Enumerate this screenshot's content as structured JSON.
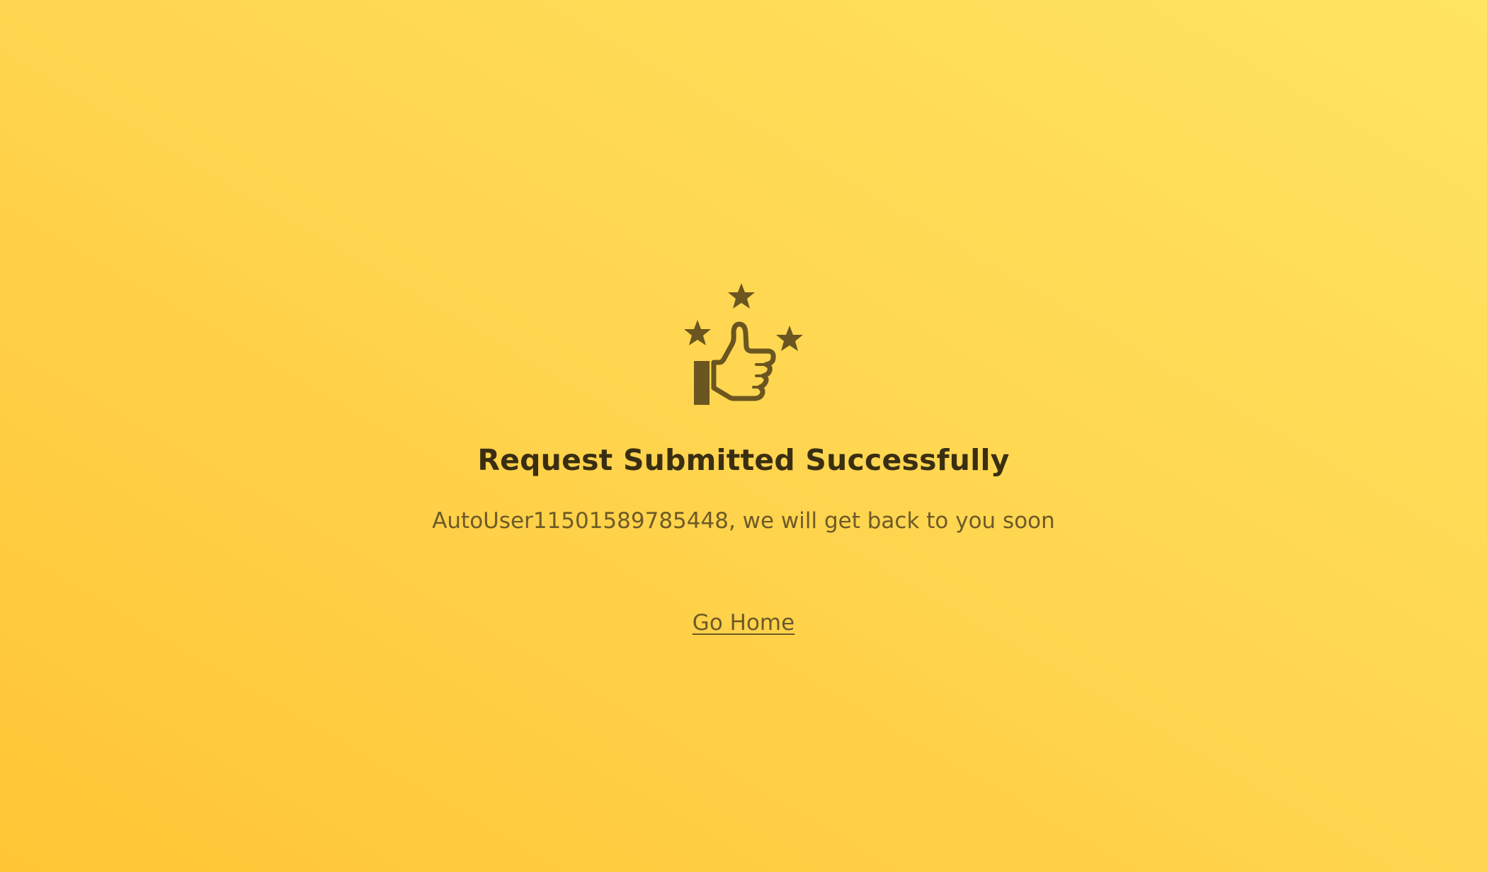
{
  "page": {
    "icon": "thumbs-up-with-stars-icon",
    "title": "Request Submitted Successfully",
    "message": "AutoUser11501589785448, we will get back to you soon",
    "home_link_label": "Go Home"
  },
  "colors": {
    "background_start": "#ffc535",
    "background_end": "#ffe461",
    "icon": "#6b5520",
    "title": "#3a2e12",
    "text": "#6d5a28"
  }
}
